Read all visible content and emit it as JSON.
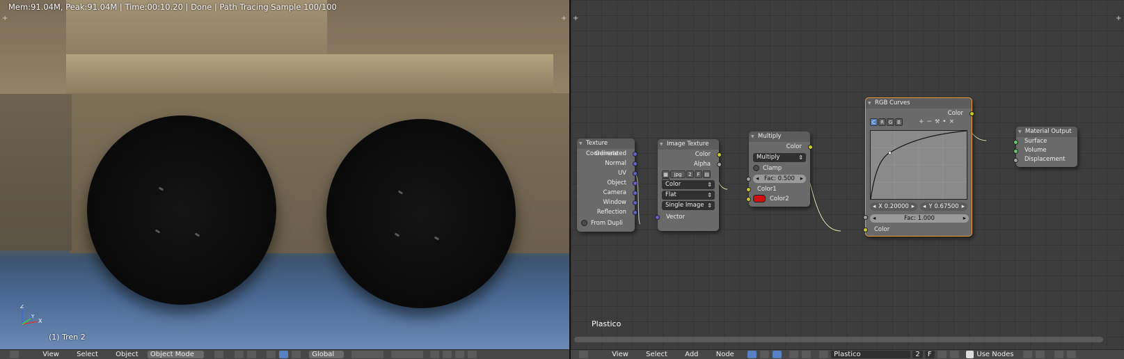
{
  "viewport": {
    "render_info": "Mem:91.04M, Peak:91.04M | Time:00:10.20 | Done | Path Tracing Sample 100/100",
    "object_label": "(1) Tren 2",
    "axis": {
      "x": "X",
      "y": "Y",
      "z": "Z"
    }
  },
  "view3d_header": {
    "menus": [
      "View",
      "Select",
      "Object"
    ],
    "mode": "Object Mode",
    "orientation": "Global"
  },
  "node_editor": {
    "material_label": "Plastico",
    "nodes": {
      "texture_coordinate": {
        "title": "Texture Coordinate",
        "outputs": [
          "Generated",
          "Normal",
          "UV",
          "Object",
          "Camera",
          "Window",
          "Reflection"
        ],
        "from_dupli": "From Dupli"
      },
      "image_texture": {
        "title": "Image Texture",
        "outputs": [
          "Color",
          "Alpha"
        ],
        "image_name": "jpg",
        "users": "2",
        "fake": "F",
        "color_space": "Color",
        "projection": "Flat",
        "source": "Single Image",
        "input": "Vector"
      },
      "multiply": {
        "title": "Multiply",
        "output": "Color",
        "blend_type": "Multiply",
        "clamp": "Clamp",
        "fac": "Fac: 0.500",
        "color1": "Color1",
        "color2": "Color2",
        "color2_swatch": "#d01010"
      },
      "rgb_curves": {
        "title": "RGB Curves",
        "output": "Color",
        "channels": [
          "C",
          "R",
          "G",
          "B"
        ],
        "tools": [
          "+",
          "−",
          "🔧",
          "•",
          "×"
        ],
        "point_x": "X 0.20000",
        "point_y": "Y 0.67500",
        "fac": "Fac: 1.000",
        "input": "Color"
      },
      "material_output": {
        "title": "Material Output",
        "inputs": [
          "Surface",
          "Volume",
          "Displacement"
        ]
      }
    }
  },
  "node_header": {
    "menus": [
      "View",
      "Select",
      "Add",
      "Node"
    ],
    "material_name": "Plastico",
    "users": "2",
    "fake": "F",
    "use_nodes": "Use Nodes"
  },
  "colors": {
    "accent": "#5680c2",
    "active_node_border": "#e69a2f",
    "socket_color": "#c7c729",
    "socket_vector": "#6363c7",
    "socket_shader": "#63c763"
  }
}
